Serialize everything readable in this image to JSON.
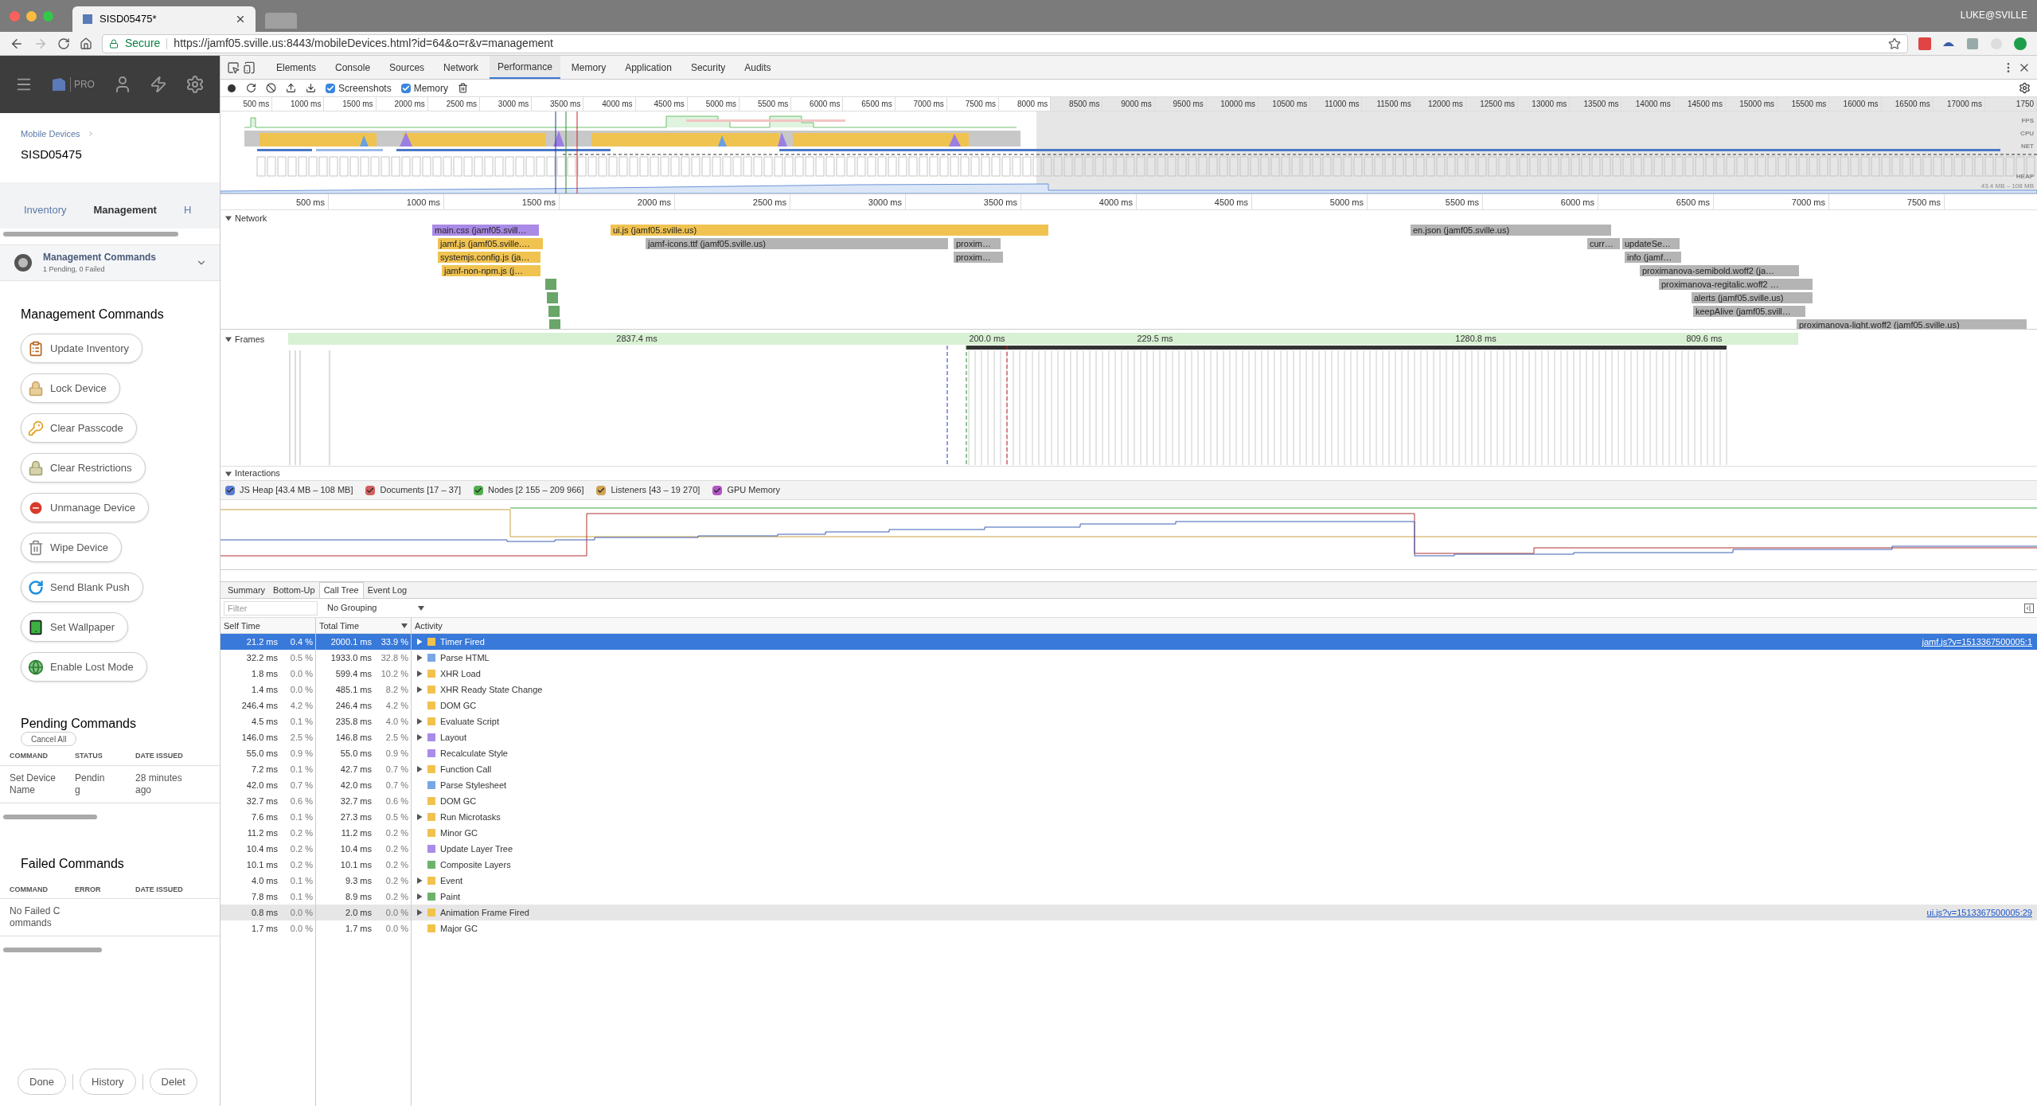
{
  "browser": {
    "tab_title": "SISD05475*",
    "user": "LUKE@SVILLE",
    "secure_label": "Secure",
    "url": "https://jamf05.sville.us:8443/mobileDevices.html?id=64&o=r&v=management"
  },
  "app": {
    "logo_text": "PRO",
    "breadcrumb": "Mobile Devices",
    "device_name": "SISD05475",
    "tabs": [
      {
        "label": "Inventory",
        "selected": false
      },
      {
        "label": "Management",
        "selected": true
      },
      {
        "label": "H",
        "selected": false
      }
    ],
    "accordion": {
      "title": "Management Commands",
      "subtitle": "1 Pending, 0 Failed",
      "expanded": false
    },
    "commands_heading": "Management Commands",
    "commands": [
      {
        "label": "Update Inventory",
        "kind": "inventory"
      },
      {
        "label": "Lock Device",
        "kind": "lock"
      },
      {
        "label": "Clear Passcode",
        "kind": "passcode"
      },
      {
        "label": "Clear Restrictions",
        "kind": "restrictions"
      },
      {
        "label": "Unmanage Device",
        "kind": "unmanage"
      },
      {
        "label": "Wipe Device",
        "kind": "wipe"
      },
      {
        "label": "Send Blank Push",
        "kind": "push"
      },
      {
        "label": "Set Wallpaper",
        "kind": "wallpaper"
      },
      {
        "label": "Enable Lost Mode",
        "kind": "lost"
      }
    ],
    "pending": {
      "heading": "Pending Commands",
      "cancel_label": "Cancel All",
      "columns": [
        "COMMAND",
        "STATUS",
        "DATE ISSUED"
      ],
      "rows": [
        [
          "Set Device Name",
          "Pending",
          "28 minutes ago"
        ]
      ]
    },
    "failed": {
      "heading": "Failed Commands",
      "columns": [
        "COMMAND",
        "ERROR",
        "DATE ISSUED"
      ],
      "empty_message": "No Failed Commands"
    },
    "footer_buttons": [
      "Done",
      "History",
      "Delet"
    ]
  },
  "devtools": {
    "tabs": [
      {
        "label": "Elements",
        "selected": false
      },
      {
        "label": "Console",
        "selected": false
      },
      {
        "label": "Sources",
        "selected": false
      },
      {
        "label": "Network",
        "selected": false
      },
      {
        "label": "Performance",
        "selected": true
      },
      {
        "label": "Memory",
        "selected": false
      },
      {
        "label": "Application",
        "selected": false
      },
      {
        "label": "Security",
        "selected": false
      },
      {
        "label": "Audits",
        "selected": false
      }
    ],
    "checkboxes": [
      {
        "label": "Screenshots",
        "checked": true
      },
      {
        "label": "Memory",
        "checked": true
      }
    ],
    "overview": {
      "ticks": [
        "500 ms",
        "1000 ms",
        "1500 ms",
        "2000 ms",
        "2500 ms",
        "3000 ms",
        "3500 ms",
        "4000 ms",
        "4500 ms",
        "5000 ms",
        "5500 ms",
        "6000 ms",
        "6500 ms",
        "7000 ms",
        "7500 ms",
        "8000 ms",
        "8500 ms",
        "9000 ms",
        "9500 ms",
        "10000 ms",
        "10500 ms",
        "11000 ms",
        "11500 ms",
        "12000 ms",
        "12500 ms",
        "13000 ms",
        "13500 ms",
        "14000 ms",
        "14500 ms",
        "15000 ms",
        "15500 ms",
        "16000 ms",
        "16500 ms",
        "17000 ms",
        "1750"
      ],
      "lanes": [
        "FPS",
        "CPU",
        "NET",
        "HEAP"
      ],
      "heap_range": "43.4 MB – 108 MB"
    },
    "network": {
      "label": "Network",
      "expanded": true,
      "ticks": [
        "500 ms",
        "1000 ms",
        "1500 ms",
        "2000 ms",
        "2500 ms",
        "3000 ms",
        "3500 ms",
        "4000 ms",
        "4500 ms",
        "5000 ms",
        "5500 ms",
        "6000 ms",
        "6500 ms",
        "7000 ms",
        "7500 ms"
      ],
      "requests": [
        {
          "label": "main.css (jamf05.svill…",
          "color": "#a98ae6"
        },
        {
          "label": "jamf.js (jamf05.sville.…",
          "color": "#f0c351"
        },
        {
          "label": "systemjs.config.js (ja…",
          "color": "#f0c351"
        },
        {
          "label": "jamf-non-npm.js (j…",
          "color": "#f0c351"
        },
        {
          "color": "#6aa56a"
        },
        {
          "color": "#6aa56a"
        },
        {
          "color": "#6aa56a"
        },
        {
          "color": "#6aa56a"
        },
        {
          "label": "ui.js (jamf05.sville.us)",
          "color": "#f0c351"
        },
        {
          "label": "jamf-icons.ttf (jamf05.sville.us)",
          "color": "#b4b4b4"
        },
        {
          "label": "proxim…",
          "color": "#b4b4b4"
        },
        {
          "label": "proxim…",
          "color": "#b4b4b4"
        },
        {
          "label": "en.json (jamf05.sville.us)",
          "color": "#b4b4b4"
        },
        {
          "label": "curr…",
          "color": "#b4b4b4"
        },
        {
          "label": "updateSe…",
          "color": "#b4b4b4"
        },
        {
          "label": "info (jamf…",
          "color": "#b4b4b4"
        },
        {
          "label": "proximanova-semibold.woff2 (ja…",
          "color": "#b4b4b4"
        },
        {
          "label": "proximanova-regitalic.woff2 …",
          "color": "#b4b4b4"
        },
        {
          "label": "alerts (jamf05.sville.us)",
          "color": "#b4b4b4"
        },
        {
          "label": "keepAlive (jamf05.svill…",
          "color": "#b4b4b4"
        },
        {
          "label": "proximanova-light.woff2 (jamf05.sville.us)",
          "color": "#b4b4b4"
        }
      ]
    },
    "frames": {
      "label": "Frames",
      "expanded": true,
      "durations": [
        "2837.4 ms",
        "200.0 ms",
        "229.5 ms",
        "1280.8 ms",
        "809.6 ms"
      ]
    },
    "interactions": {
      "label": "Interactions",
      "expanded": true
    },
    "counters": [
      {
        "label": "JS Heap [43.4 MB – 108 MB]",
        "color": "#5a7bd2",
        "checked": true
      },
      {
        "label": "Documents [17 – 37]",
        "color": "#d05f5f",
        "checked": true
      },
      {
        "label": "Nodes [2 155 – 209 966]",
        "color": "#4fae4f",
        "checked": true
      },
      {
        "label": "Listeners [43 – 19 270]",
        "color": "#d0a254",
        "checked": true
      },
      {
        "label": "GPU Memory",
        "color": "#b155c4",
        "checked": true
      }
    ],
    "bottom_tabs": [
      {
        "label": "Summary",
        "selected": false
      },
      {
        "label": "Bottom-Up",
        "selected": false
      },
      {
        "label": "Call Tree",
        "selected": true
      },
      {
        "label": "Event Log",
        "selected": false
      }
    ],
    "filter_placeholder": "Filter",
    "grouping": "No Grouping",
    "columns": [
      "Self Time",
      "Total Time",
      "Activity"
    ],
    "rows": [
      {
        "self_time": "21.2 ms",
        "self_pct": "0.4 %",
        "total_time": "2000.1 ms",
        "total_pct": "33.9 %",
        "expandable": true,
        "color": "#f2c14e",
        "activity": "Timer Fired",
        "selected": true,
        "highlighted": false,
        "link": "jamf.js?v=1513367500005:1"
      },
      {
        "self_time": "32.2 ms",
        "self_pct": "0.5 %",
        "total_time": "1933.0 ms",
        "total_pct": "32.8 %",
        "expandable": true,
        "color": "#7aa6e6",
        "activity": "Parse HTML",
        "selected": false,
        "highlighted": false
      },
      {
        "self_time": "1.8 ms",
        "self_pct": "0.0 %",
        "total_time": "599.4 ms",
        "total_pct": "10.2 %",
        "expandable": true,
        "color": "#f2c14e",
        "activity": "XHR Load",
        "selected": false,
        "highlighted": false
      },
      {
        "self_time": "1.4 ms",
        "self_pct": "0.0 %",
        "total_time": "485.1 ms",
        "total_pct": "8.2 %",
        "expandable": true,
        "color": "#f2c14e",
        "activity": "XHR Ready State Change",
        "selected": false,
        "highlighted": false
      },
      {
        "self_time": "246.4 ms",
        "self_pct": "4.2 %",
        "total_time": "246.4 ms",
        "total_pct": "4.2 %",
        "expandable": false,
        "color": "#f2c14e",
        "activity": "DOM GC",
        "selected": false,
        "highlighted": false
      },
      {
        "self_time": "4.5 ms",
        "self_pct": "0.1 %",
        "total_time": "235.8 ms",
        "total_pct": "4.0 %",
        "expandable": true,
        "color": "#f2c14e",
        "activity": "Evaluate Script",
        "selected": false,
        "highlighted": false
      },
      {
        "self_time": "146.0 ms",
        "self_pct": "2.5 %",
        "total_time": "146.8 ms",
        "total_pct": "2.5 %",
        "expandable": true,
        "color": "#a78de8",
        "activity": "Layout",
        "selected": false,
        "highlighted": false
      },
      {
        "self_time": "55.0 ms",
        "self_pct": "0.9 %",
        "total_time": "55.0 ms",
        "total_pct": "0.9 %",
        "expandable": false,
        "color": "#a78de8",
        "activity": "Recalculate Style",
        "selected": false,
        "highlighted": false
      },
      {
        "self_time": "7.2 ms",
        "self_pct": "0.1 %",
        "total_time": "42.7 ms",
        "total_pct": "0.7 %",
        "expandable": true,
        "color": "#f2c14e",
        "activity": "Function Call",
        "selected": false,
        "highlighted": false
      },
      {
        "self_time": "42.0 ms",
        "self_pct": "0.7 %",
        "total_time": "42.0 ms",
        "total_pct": "0.7 %",
        "expandable": false,
        "color": "#7aa6e6",
        "activity": "Parse Stylesheet",
        "selected": false,
        "highlighted": false
      },
      {
        "self_time": "32.7 ms",
        "self_pct": "0.6 %",
        "total_time": "32.7 ms",
        "total_pct": "0.6 %",
        "expandable": false,
        "color": "#f2c14e",
        "activity": "DOM GC",
        "selected": false,
        "highlighted": false
      },
      {
        "self_time": "7.6 ms",
        "self_pct": "0.1 %",
        "total_time": "27.3 ms",
        "total_pct": "0.5 %",
        "expandable": true,
        "color": "#f2c14e",
        "activity": "Run Microtasks",
        "selected": false,
        "highlighted": false
      },
      {
        "self_time": "11.2 ms",
        "self_pct": "0.2 %",
        "total_time": "11.2 ms",
        "total_pct": "0.2 %",
        "expandable": false,
        "color": "#f2c14e",
        "activity": "Minor GC",
        "selected": false,
        "highlighted": false
      },
      {
        "self_time": "10.4 ms",
        "self_pct": "0.2 %",
        "total_time": "10.4 ms",
        "total_pct": "0.2 %",
        "expandable": false,
        "color": "#a78de8",
        "activity": "Update Layer Tree",
        "selected": false,
        "highlighted": false
      },
      {
        "self_time": "10.1 ms",
        "self_pct": "0.2 %",
        "total_time": "10.1 ms",
        "total_pct": "0.2 %",
        "expandable": false,
        "color": "#6db36d",
        "activity": "Composite Layers",
        "selected": false,
        "highlighted": false
      },
      {
        "self_time": "4.0 ms",
        "self_pct": "0.1 %",
        "total_time": "9.3 ms",
        "total_pct": "0.2 %",
        "expandable": true,
        "color": "#f2c14e",
        "activity": "Event",
        "selected": false,
        "highlighted": false
      },
      {
        "self_time": "7.8 ms",
        "self_pct": "0.1 %",
        "total_time": "8.9 ms",
        "total_pct": "0.2 %",
        "expandable": true,
        "color": "#6db36d",
        "activity": "Paint",
        "selected": false,
        "highlighted": false
      },
      {
        "self_time": "0.8 ms",
        "self_pct": "0.0 %",
        "total_time": "2.0 ms",
        "total_pct": "0.0 %",
        "expandable": true,
        "color": "#f2c14e",
        "activity": "Animation Frame Fired",
        "selected": false,
        "highlighted": true,
        "link": "ui.js?v=1513367500005:29"
      },
      {
        "self_time": "1.7 ms",
        "self_pct": "0.0 %",
        "total_time": "1.7 ms",
        "total_pct": "0.0 %",
        "expandable": false,
        "color": "#f2c14e",
        "activity": "Major GC",
        "selected": false,
        "highlighted": false
      }
    ]
  }
}
